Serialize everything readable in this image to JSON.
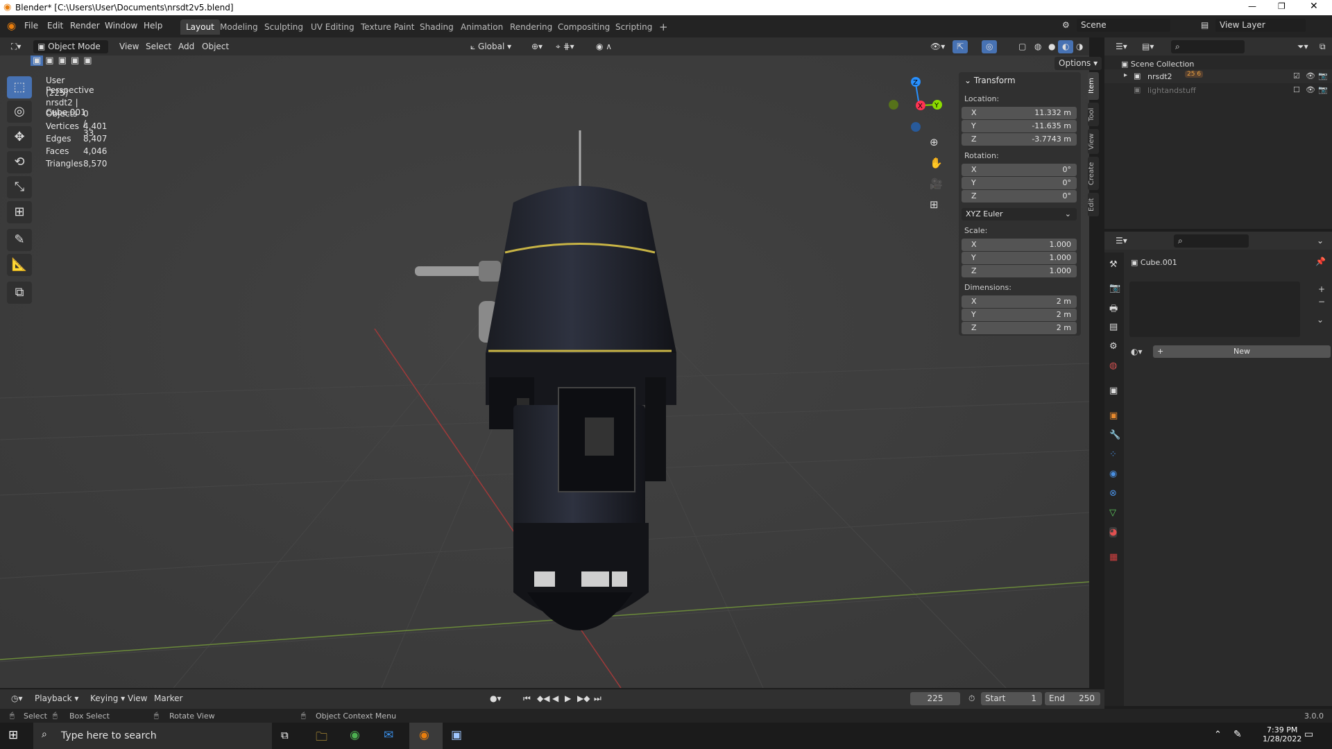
{
  "window": {
    "title": "Blender* [C:\\Users\\User\\Documents\\nrsdt2v5.blend]"
  },
  "menu": [
    "File",
    "Edit",
    "Render",
    "Window",
    "Help"
  ],
  "workspaces": [
    "Layout",
    "Modeling",
    "Sculpting",
    "UV Editing",
    "Texture Paint",
    "Shading",
    "Animation",
    "Rendering",
    "Compositing",
    "Scripting"
  ],
  "add_workspace": "+",
  "scene": {
    "label": "Scene",
    "view_layer": "View Layer"
  },
  "viewport_header": {
    "mode": "Object Mode",
    "menus": [
      "View",
      "Select",
      "Add",
      "Object"
    ],
    "orientation": "Global",
    "options": "Options"
  },
  "viewport": {
    "view_name": "User Perspective",
    "object_info": "(225) nrsdt2 | Cube.001",
    "stats": [
      {
        "label": "Objects",
        "value": "0 / 33"
      },
      {
        "label": "Vertices",
        "value": "4,401"
      },
      {
        "label": "Edges",
        "value": "8,407"
      },
      {
        "label": "Faces",
        "value": "4,046"
      },
      {
        "label": "Triangles",
        "value": "8,570"
      }
    ],
    "gizmo": {
      "x": "X",
      "y": "Y",
      "z": "Z"
    }
  },
  "transform": {
    "title": "Transform",
    "location_label": "Location:",
    "location": [
      {
        "axis": "X",
        "value": "11.332 m"
      },
      {
        "axis": "Y",
        "value": "-11.635 m"
      },
      {
        "axis": "Z",
        "value": "-3.7743 m"
      }
    ],
    "rotation_label": "Rotation:",
    "rotation": [
      {
        "axis": "X",
        "value": "0°"
      },
      {
        "axis": "Y",
        "value": "0°"
      },
      {
        "axis": "Z",
        "value": "0°"
      }
    ],
    "rotation_mode": "XYZ Euler",
    "scale_label": "Scale:",
    "scale": [
      {
        "axis": "X",
        "value": "1.000"
      },
      {
        "axis": "Y",
        "value": "1.000"
      },
      {
        "axis": "Z",
        "value": "1.000"
      }
    ],
    "dimensions_label": "Dimensions:",
    "dimensions": [
      {
        "axis": "X",
        "value": "2 m"
      },
      {
        "axis": "Y",
        "value": "2 m"
      },
      {
        "axis": "Z",
        "value": "2 m"
      }
    ]
  },
  "side_tabs": [
    "Item",
    "Tool",
    "View",
    "Create",
    "Edit"
  ],
  "outliner": {
    "root": "Scene Collection",
    "items": [
      {
        "name": "nrsdt2",
        "badges": "25 6"
      },
      {
        "name": "lightandstuff"
      }
    ]
  },
  "properties": {
    "object": "Cube.001",
    "new_button": "New"
  },
  "timeline": {
    "menus": [
      "Playback",
      "Keying",
      "View",
      "Marker"
    ],
    "current_frame": "225",
    "start_label": "Start",
    "start": "1",
    "end_label": "End",
    "end": "250"
  },
  "statusbar": {
    "select": "Select",
    "box_select": "Box Select",
    "rotate": "Rotate View",
    "context": "Object Context Menu",
    "version": "3.0.0"
  },
  "taskbar": {
    "search_placeholder": "Type here to search",
    "time": "7:39 PM",
    "date": "1/28/2022"
  },
  "colors": {
    "accent": "#4772b3",
    "x_axis": "#ff3352",
    "y_axis": "#8bdc00",
    "z_axis": "#2890ff",
    "robot_trim": "#c8b445"
  }
}
